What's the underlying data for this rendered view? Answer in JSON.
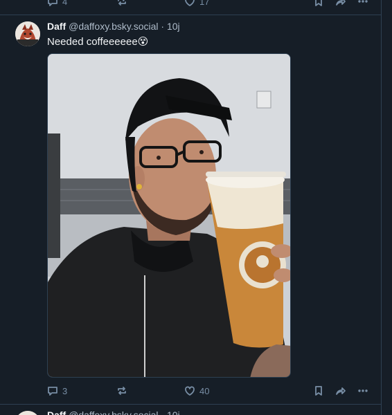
{
  "prev_post": {
    "reply_count": "4",
    "like_count": "17"
  },
  "post": {
    "author_name": "Daff",
    "author_handle": "@daffoxy.bsky.social",
    "separator": " · ",
    "time_ago": "10j",
    "text": "Needed coffeeeeee",
    "emoji": "😵",
    "reply_count": "3",
    "like_count": "40",
    "repost_count": ""
  },
  "next_post": {
    "author_name": "Daff",
    "author_handle": "@daffoxy.bsky.social",
    "separator": " · ",
    "time_ago": "10j"
  },
  "colors": {
    "background": "#161e27",
    "divider": "#2e4052",
    "muted": "#788ea5",
    "text": "#f1f3f5"
  },
  "icons": [
    "reply-icon",
    "repost-icon",
    "like-icon",
    "bookmark-icon",
    "share-icon",
    "more-icon"
  ]
}
